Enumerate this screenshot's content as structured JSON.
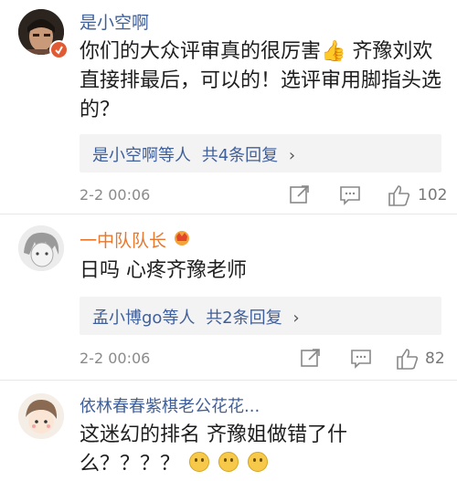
{
  "comments": [
    {
      "username": "是小空啊",
      "body": "你们的大众评审真的很厉害👍 齐豫刘欢直接排最后，可以的！选评审用脚指头选的？",
      "replies_prefix": "是小空啊等人",
      "replies_count": "共4条回复",
      "replies_chevron": "›",
      "time": "2-2 00:06",
      "likes": "102"
    },
    {
      "username": "一中队队长",
      "body": "日吗 心疼齐豫老师",
      "replies_prefix": "孟小博go等人",
      "replies_count": "共2条回复",
      "replies_chevron": "›",
      "time": "2-2 00:06",
      "likes": "82"
    },
    {
      "username": "依林春春紫棋老公花花...",
      "body_line1": "这迷幻的排名 齐豫姐做错了什",
      "body_line2": "么？？？？"
    }
  ],
  "colors": {
    "username_blue": "#3f5f9a",
    "username_orange": "#e8772e",
    "text": "#1e1e1e",
    "meta": "#8a8a8a"
  },
  "icons": [
    "share-icon",
    "comment-icon",
    "like-icon",
    "verified-badge-icon",
    "vip-crown-icon",
    "smile-emoji-icon"
  ]
}
